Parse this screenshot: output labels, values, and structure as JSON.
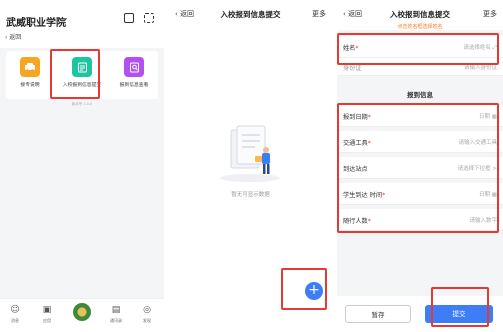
{
  "panel1": {
    "school": "武威职业学院",
    "back": "‹ 返回",
    "tiles": [
      {
        "label": "接专说明",
        "icon": "car-icon",
        "color": "#f6a623"
      },
      {
        "label": "入校报到信息提交",
        "icon": "form-icon",
        "color": "#1ec6a0"
      },
      {
        "label": "报到信息查看",
        "icon": "document-icon",
        "color": "#b44ff2"
      }
    ],
    "version": "版本号 1.0.0",
    "tabs": [
      {
        "label": "消息",
        "icon": "message-icon"
      },
      {
        "label": "应用",
        "icon": "apps-icon"
      },
      {
        "label": "",
        "icon": "emblem-icon"
      },
      {
        "label": "通讯录",
        "icon": "contacts-icon"
      },
      {
        "label": "发现",
        "icon": "compass-icon"
      }
    ]
  },
  "panel2": {
    "back": "‹ 返回",
    "title": "入校报到信息提交",
    "more": "更多",
    "empty": "暂无可显示数据",
    "fab": "+"
  },
  "panel3": {
    "back": "‹ 返回",
    "title": "入校报到信息提交",
    "more": "更多",
    "hint": "点击姓名框选择姓名",
    "name_label": "姓名",
    "name_placeholder": "请选择姓名",
    "idcard_label": "身份证",
    "idcard_placeholder": "请输入身份证",
    "section": "报到信息",
    "fields": [
      {
        "label": "报到日期",
        "required": "*",
        "value": "日期"
      },
      {
        "label": "交通工具",
        "required": "*",
        "value": "请输入交通工具"
      },
      {
        "label": "到达站点",
        "required": "",
        "value": "请选择下拉框 >"
      },
      {
        "label": "学生到达 时间",
        "required": "*",
        "value": "日期"
      },
      {
        "label": "随行人数",
        "required": "*",
        "value": "请输入数字"
      }
    ],
    "save": "暂存",
    "submit": "提交",
    "accent": "#3d7ef6"
  }
}
